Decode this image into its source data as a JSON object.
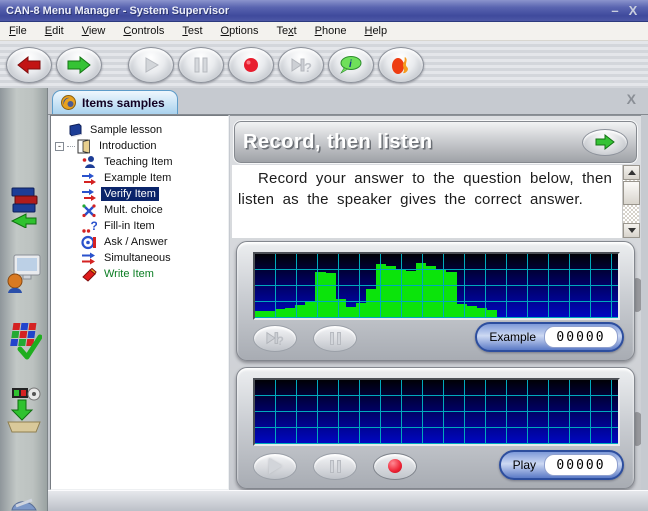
{
  "window": {
    "title": "CAN-8 Menu Manager - System Supervisor",
    "minimize_glyph": "–",
    "close_glyph": "X",
    "inner_close_glyph": "x"
  },
  "menu": {
    "items": [
      {
        "pre": "",
        "key": "F",
        "post": "ile"
      },
      {
        "pre": "",
        "key": "E",
        "post": "dit"
      },
      {
        "pre": "",
        "key": "V",
        "post": "iew"
      },
      {
        "pre": "",
        "key": "C",
        "post": "ontrols"
      },
      {
        "pre": "",
        "key": "T",
        "post": "est"
      },
      {
        "pre": "",
        "key": "O",
        "post": "ptions"
      },
      {
        "pre": "Te",
        "key": "x",
        "post": "t"
      },
      {
        "pre": "",
        "key": "P",
        "post": "hone"
      },
      {
        "pre": "",
        "key": "H",
        "post": "elp"
      }
    ]
  },
  "toolbar": {
    "buttons": [
      {
        "icon": "back-red-arrow",
        "enabled": true
      },
      {
        "icon": "forward-green-arrow",
        "enabled": true
      },
      {
        "icon": "play",
        "enabled": false
      },
      {
        "icon": "pause",
        "enabled": false
      },
      {
        "icon": "record",
        "enabled": true
      },
      {
        "icon": "skip-question",
        "enabled": false
      },
      {
        "icon": "info-bubble",
        "enabled": true
      },
      {
        "icon": "sound-flame",
        "enabled": true
      }
    ]
  },
  "sidebar": {
    "icons": [
      "lesson-books",
      "workstation",
      "planner-grid",
      "media-import",
      "tool-partial"
    ]
  },
  "tab": {
    "label": "Items samples",
    "icon": "globe"
  },
  "tree": {
    "items": [
      {
        "label": "Sample lesson",
        "icon": "book",
        "depth": 0
      },
      {
        "label": "Introduction",
        "icon": "open-door",
        "depth": 0,
        "expander": "-"
      },
      {
        "label": "Teaching Item",
        "icon": "teaching-person",
        "depth": 1
      },
      {
        "label": "Example Item",
        "icon": "blue-red-arrows",
        "depth": 1
      },
      {
        "label": "Verify Item",
        "icon": "blue-red-arrows",
        "depth": 1,
        "selected": true
      },
      {
        "label": "Mult. choice",
        "icon": "multi-dots",
        "depth": 1
      },
      {
        "label": "Fill-in Item",
        "icon": "dots-question",
        "depth": 1
      },
      {
        "label": "Ask / Answer",
        "icon": "ask-answer",
        "depth": 1
      },
      {
        "label": "Simultaneous",
        "icon": "double-arrows",
        "depth": 1
      },
      {
        "label": "Write Item",
        "icon": "eraser",
        "depth": 1,
        "color": "green"
      }
    ]
  },
  "header": {
    "title": "Record, then listen",
    "button_icon": "green-right-arrow"
  },
  "instructions": {
    "text": "Record your answer to the question below, then listen as the speaker gives the correct answer."
  },
  "example_panel": {
    "label": "Example",
    "value": "00000",
    "buttons": [
      "skip-question",
      "pause"
    ]
  },
  "play_panel": {
    "label": "Play",
    "value": "00000",
    "buttons": [
      "play",
      "pause",
      "record"
    ]
  },
  "chart_data": [
    {
      "type": "bar",
      "name": "example-waveform",
      "title": "recorded example waveform (green level bars on blue grid)",
      "ylim": [
        0,
        1
      ],
      "grid": true,
      "values": [
        0.11,
        0.11,
        0.14,
        0.15,
        0.21,
        0.27,
        0.72,
        0.7,
        0.3,
        0.17,
        0.24,
        0.45,
        0.84,
        0.81,
        0.77,
        0.74,
        0.86,
        0.81,
        0.75,
        0.72,
        0.22,
        0.19,
        0.16,
        0.13,
        0,
        0,
        0,
        0,
        0,
        0,
        0,
        0,
        0,
        0,
        0,
        0
      ]
    },
    {
      "type": "bar",
      "name": "student-waveform",
      "title": "empty student recording waveform",
      "ylim": [
        0,
        1
      ],
      "grid": true,
      "values": [
        0,
        0,
        0,
        0,
        0,
        0,
        0,
        0,
        0,
        0,
        0,
        0,
        0,
        0,
        0,
        0,
        0,
        0,
        0,
        0,
        0,
        0,
        0,
        0,
        0,
        0,
        0,
        0,
        0,
        0,
        0,
        0,
        0,
        0,
        0,
        0
      ]
    }
  ],
  "colors": {
    "titlebar_blue": "#4a55a4",
    "selection_navy": "#0a246a",
    "display_blue": "#0007c4",
    "grid_cyan": "#00a9bc",
    "bar_green": "#0be40b",
    "pill_blue": "#5b7ac6",
    "record_red": "#ee2335",
    "write_item_green": "#0a7d22"
  }
}
